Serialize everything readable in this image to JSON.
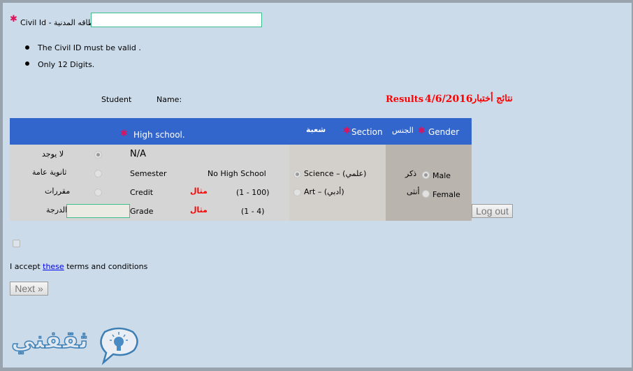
{
  "civil_id": {
    "label": "Civil Id - البطاقه المدنية",
    "value": "",
    "notes": [
      "The Civil ID must be valid .",
      "Only 12 Digits."
    ]
  },
  "header_row": {
    "student": "Student",
    "name": "Name:",
    "results": "Results",
    "date": "4/6/2016",
    "results_ar": "نتائج أختبار"
  },
  "table": {
    "high_school_label": "High school.",
    "section_ar": "شعبة",
    "section_label": "Section",
    "gender_ar": "الجنس",
    "gender_label": "Gender",
    "high_school_rows": [
      {
        "ar": "لا يوجد",
        "label": "N/A",
        "selected": true
      },
      {
        "ar": "ثانوية عامة",
        "label": "Semester",
        "value": "No High School",
        "selected": false
      },
      {
        "ar": "مقررات",
        "label": "Credit",
        "example": "مثال",
        "range": "(1 - 100)",
        "selected": false
      },
      {
        "ar": "الدرجة",
        "label": "Grade",
        "example": "مثال",
        "range": "(1 - 4)",
        "input_value": ""
      }
    ],
    "sections": [
      {
        "label": "Science  –  (علمي)",
        "selected": true
      },
      {
        "label": "Art  –  (أدبي)",
        "selected": false
      }
    ],
    "genders": [
      {
        "ar": "ذكر",
        "label": "Male",
        "selected": true
      },
      {
        "ar": "أنثى",
        "label": "Female",
        "selected": false
      }
    ]
  },
  "logout": "Log out",
  "terms": {
    "checked": false,
    "prefix": "I accept ",
    "link": "these",
    "suffix": " terms and conditions"
  },
  "next": "Next »",
  "logo": {
    "text": "ثقفني"
  },
  "colors": {
    "header_blue": "#3366cc",
    "star": "#e0105a",
    "red": "#ff0000",
    "background": "#cbdbea"
  }
}
